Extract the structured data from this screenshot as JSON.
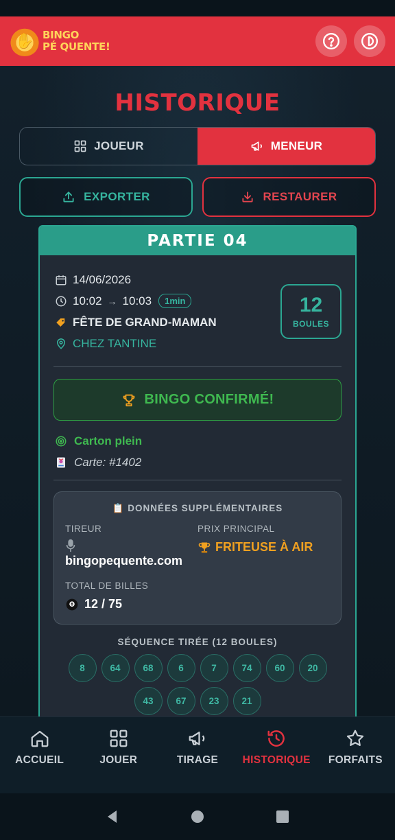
{
  "app": {
    "logo_line1": "BINGO",
    "logo_line2": "PÉ QUENTE!",
    "accent_color": "#e2323f",
    "teal_color": "#2ba792",
    "success_color": "#3fb950",
    "gold_color": "#f0a020"
  },
  "header": {
    "help_icon": "question-circle-icon",
    "power_icon": "power-icon"
  },
  "page": {
    "title": "HISTORIQUE"
  },
  "mode_toggle": {
    "options": [
      {
        "label": "JOUEUR",
        "icon": "grid-icon",
        "selected": false
      },
      {
        "label": "MENEUR",
        "icon": "megaphone-icon",
        "selected": true
      }
    ]
  },
  "actions": {
    "export_label": "EXPORTER",
    "restore_label": "RESTAURER"
  },
  "game": {
    "title": "PARTIE 04",
    "date": "14/06/2026",
    "start_time": "10:02",
    "arrow": "→",
    "end_time": "10:03",
    "duration": "1min",
    "event_name": "FÊTE DE GRAND-MAMAN",
    "location": "CHEZ TANTINE",
    "balls_count": "12",
    "balls_label": "BOULES",
    "bingo_label": "BINGO CONFIRMÉ!",
    "win_type": "Carton plein",
    "card_label": "Carte: #1402",
    "extra": {
      "title": "DONNÉES SUPPLÉMENTAIRES",
      "caller_label": "TIREUR",
      "caller_value": "bingopequente.com",
      "prize_label": "PRIX PRINCIPAL",
      "prize_value": "FRITEUSE À AIR",
      "total_label": "TOTAL DE BILLES",
      "total_value": "12 / 75"
    },
    "sequence_title": "SÉQUENCE TIRÉE (12 BOULES)",
    "sequence": [
      "8",
      "64",
      "68",
      "6",
      "7",
      "74",
      "60",
      "20",
      "43",
      "67",
      "23",
      "21"
    ]
  },
  "bottom_nav": {
    "items": [
      {
        "label": "ACCUEIL",
        "icon": "home-icon",
        "active": false
      },
      {
        "label": "JOUER",
        "icon": "grid-icon",
        "active": false
      },
      {
        "label": "TIRAGE",
        "icon": "megaphone-icon",
        "active": false
      },
      {
        "label": "HISTORIQUE",
        "icon": "history-icon",
        "active": true
      },
      {
        "label": "FORFAITS",
        "icon": "star-icon",
        "active": false
      }
    ]
  }
}
